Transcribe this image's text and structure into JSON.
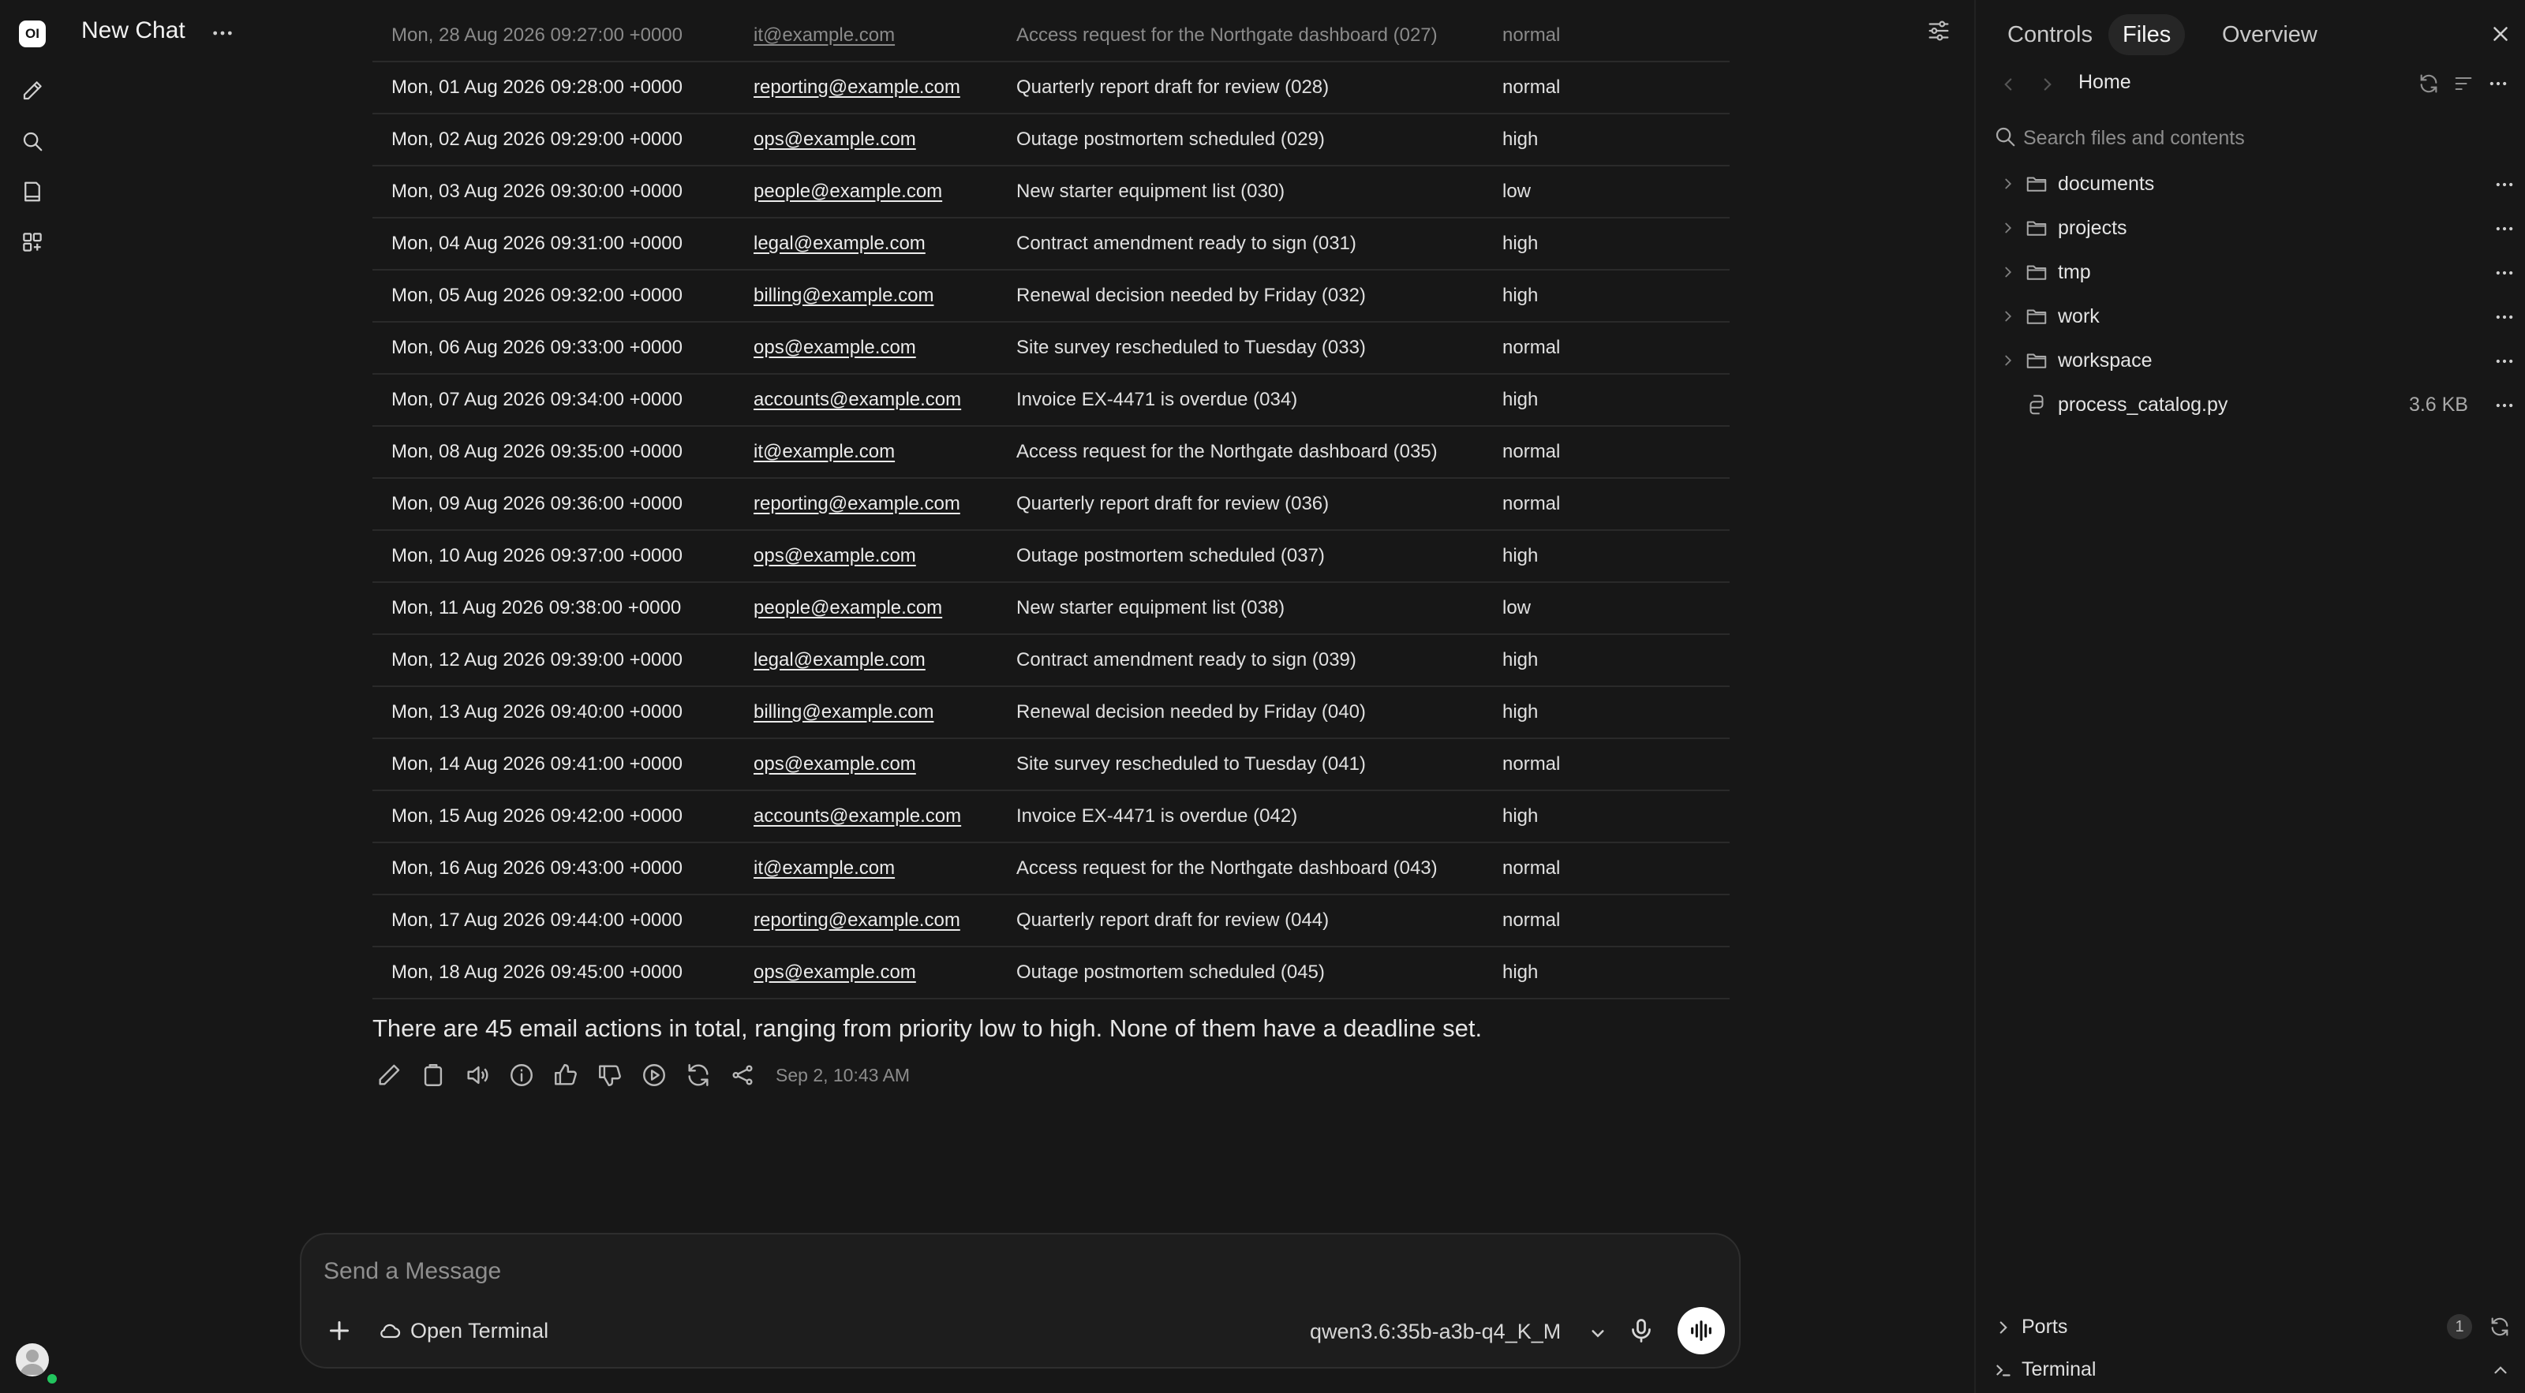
{
  "app": {
    "logo_text": "OI",
    "chat_title": "New Chat"
  },
  "icons": {
    "rail": [
      "new-chat-pencil-icon",
      "search-icon",
      "notes-icon",
      "workspace-grid-icon"
    ],
    "message_actions": [
      "edit-icon",
      "copy-icon",
      "read-aloud-icon",
      "info-icon",
      "thumbs-up-icon",
      "thumbs-down-icon",
      "continue-icon",
      "regenerate-icon",
      "share-icon"
    ]
  },
  "table": {
    "rows": [
      {
        "date": "Mon, 28 Aug 2026 09:27:00 +0000",
        "from": "it@example.com",
        "subject": "Access request for the Northgate dashboard (027)",
        "priority": "normal"
      },
      {
        "date": "Mon, 01 Aug 2026 09:28:00 +0000",
        "from": "reporting@example.com",
        "subject": "Quarterly report draft for review (028)",
        "priority": "normal"
      },
      {
        "date": "Mon, 02 Aug 2026 09:29:00 +0000",
        "from": "ops@example.com",
        "subject": "Outage postmortem scheduled (029)",
        "priority": "high"
      },
      {
        "date": "Mon, 03 Aug 2026 09:30:00 +0000",
        "from": "people@example.com",
        "subject": "New starter equipment list (030)",
        "priority": "low"
      },
      {
        "date": "Mon, 04 Aug 2026 09:31:00 +0000",
        "from": "legal@example.com",
        "subject": "Contract amendment ready to sign (031)",
        "priority": "high"
      },
      {
        "date": "Mon, 05 Aug 2026 09:32:00 +0000",
        "from": "billing@example.com",
        "subject": "Renewal decision needed by Friday (032)",
        "priority": "high"
      },
      {
        "date": "Mon, 06 Aug 2026 09:33:00 +0000",
        "from": "ops@example.com",
        "subject": "Site survey rescheduled to Tuesday (033)",
        "priority": "normal"
      },
      {
        "date": "Mon, 07 Aug 2026 09:34:00 +0000",
        "from": "accounts@example.com",
        "subject": "Invoice EX-4471 is overdue (034)",
        "priority": "high"
      },
      {
        "date": "Mon, 08 Aug 2026 09:35:00 +0000",
        "from": "it@example.com",
        "subject": "Access request for the Northgate dashboard (035)",
        "priority": "normal"
      },
      {
        "date": "Mon, 09 Aug 2026 09:36:00 +0000",
        "from": "reporting@example.com",
        "subject": "Quarterly report draft for review (036)",
        "priority": "normal"
      },
      {
        "date": "Mon, 10 Aug 2026 09:37:00 +0000",
        "from": "ops@example.com",
        "subject": "Outage postmortem scheduled (037)",
        "priority": "high"
      },
      {
        "date": "Mon, 11 Aug 2026 09:38:00 +0000",
        "from": "people@example.com",
        "subject": "New starter equipment list (038)",
        "priority": "low"
      },
      {
        "date": "Mon, 12 Aug 2026 09:39:00 +0000",
        "from": "legal@example.com",
        "subject": "Contract amendment ready to sign (039)",
        "priority": "high"
      },
      {
        "date": "Mon, 13 Aug 2026 09:40:00 +0000",
        "from": "billing@example.com",
        "subject": "Renewal decision needed by Friday (040)",
        "priority": "high"
      },
      {
        "date": "Mon, 14 Aug 2026 09:41:00 +0000",
        "from": "ops@example.com",
        "subject": "Site survey rescheduled to Tuesday (041)",
        "priority": "normal"
      },
      {
        "date": "Mon, 15 Aug 2026 09:42:00 +0000",
        "from": "accounts@example.com",
        "subject": "Invoice EX-4471 is overdue (042)",
        "priority": "high"
      },
      {
        "date": "Mon, 16 Aug 2026 09:43:00 +0000",
        "from": "it@example.com",
        "subject": "Access request for the Northgate dashboard (043)",
        "priority": "normal"
      },
      {
        "date": "Mon, 17 Aug 2026 09:44:00 +0000",
        "from": "reporting@example.com",
        "subject": "Quarterly report draft for review (044)",
        "priority": "normal"
      },
      {
        "date": "Mon, 18 Aug 2026 09:45:00 +0000",
        "from": "ops@example.com",
        "subject": "Outage postmortem scheduled (045)",
        "priority": "high"
      }
    ]
  },
  "message": {
    "summary": "There are 45 email actions in total, ranging from priority low to high. None of them have a deadline set.",
    "timestamp": "Sep 2, 10:43 AM"
  },
  "composer": {
    "placeholder": "Send a Message",
    "open_terminal_label": "Open Terminal",
    "model": "qwen3.6:35b-a3b-q4_K_M"
  },
  "panel": {
    "tabs": [
      "Controls",
      "Files",
      "Overview"
    ],
    "active_tab": "Files",
    "home_label": "Home",
    "search_placeholder": "Search files and contents",
    "tree": [
      {
        "name": "documents",
        "type": "folder"
      },
      {
        "name": "projects",
        "type": "folder"
      },
      {
        "name": "tmp",
        "type": "folder"
      },
      {
        "name": "work",
        "type": "folder"
      },
      {
        "name": "workspace",
        "type": "folder"
      },
      {
        "name": "process_catalog.py",
        "type": "file",
        "size": "3.6 KB"
      }
    ],
    "ports_label": "Ports",
    "ports_count": "1",
    "terminal_label": "Terminal"
  }
}
